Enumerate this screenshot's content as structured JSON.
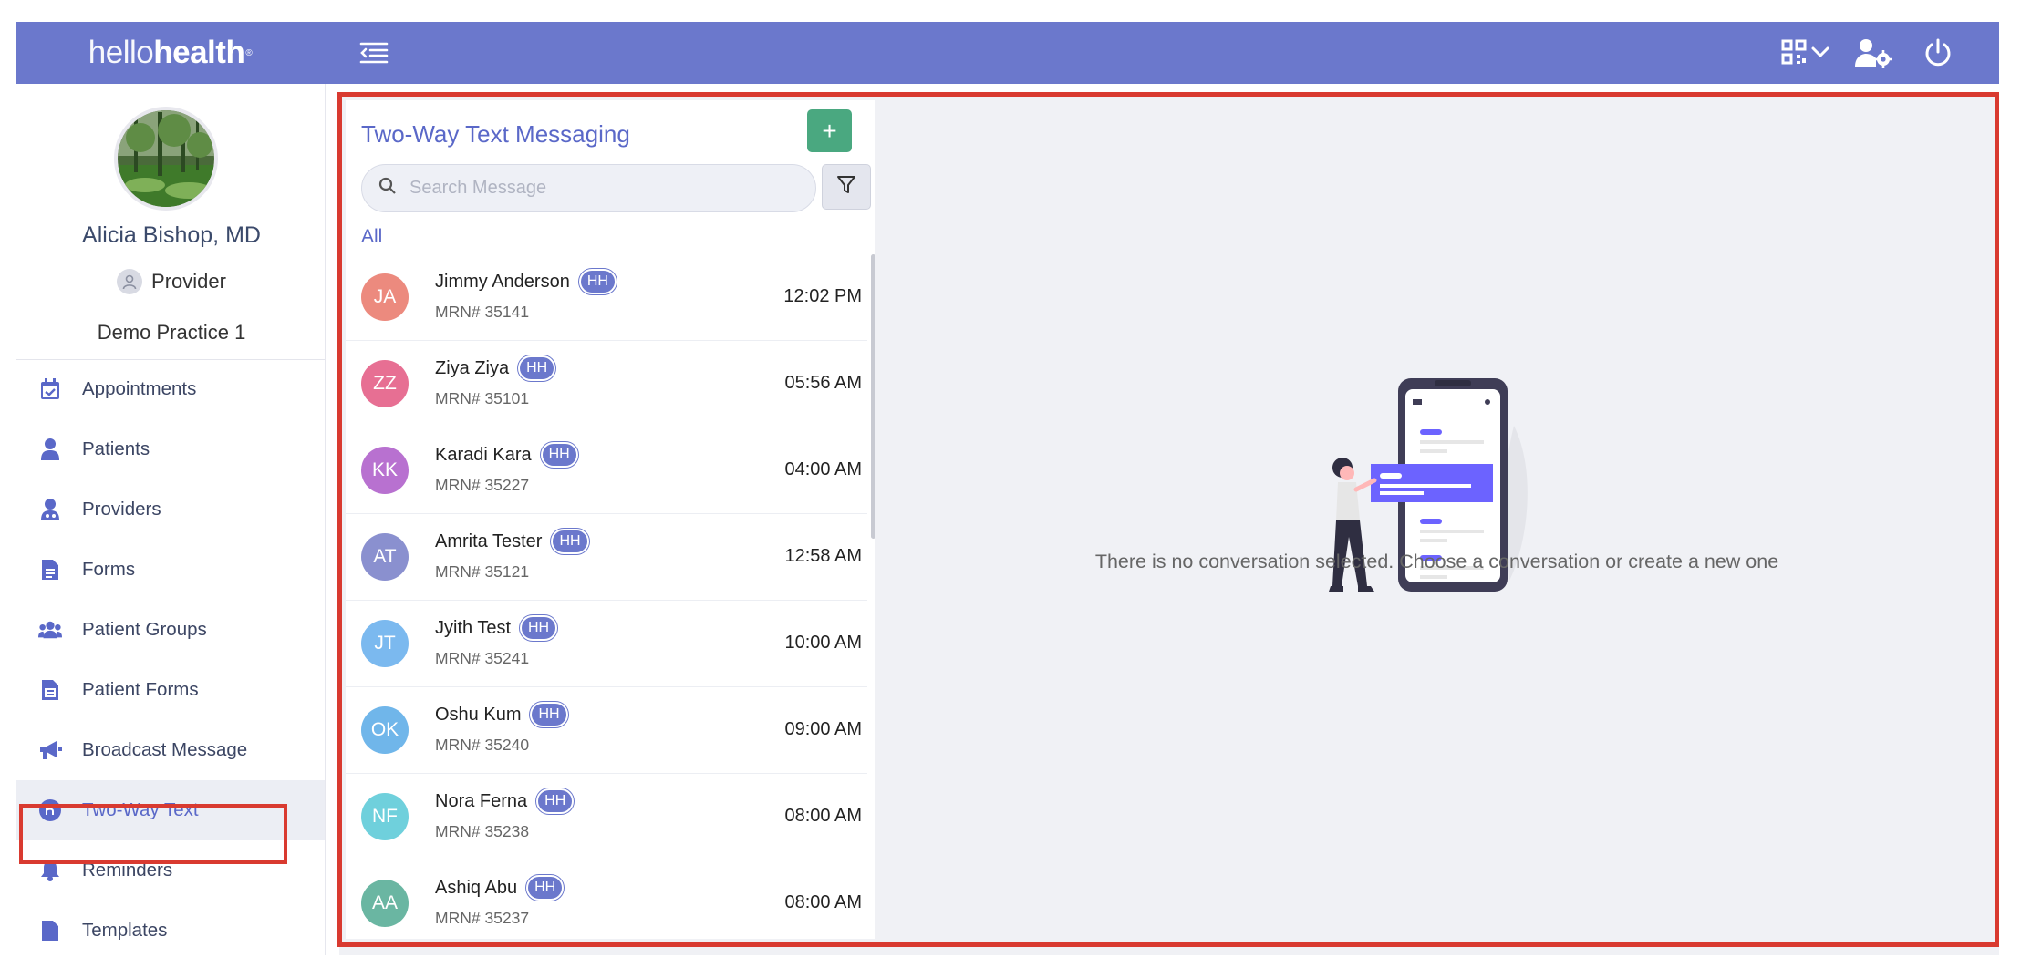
{
  "topbar": {
    "logo_light": "hello",
    "logo_bold": "health",
    "logo_mark": "®",
    "icons": [
      "menu-toggle-icon",
      "qr-code-icon",
      "user-settings-icon",
      "power-icon"
    ]
  },
  "profile": {
    "name": "Alicia Bishop, MD",
    "role": "Provider",
    "practice": "Demo Practice 1"
  },
  "sidebar": {
    "items": [
      {
        "label": "Appointments",
        "icon": "calendar-check-icon"
      },
      {
        "label": "Patients",
        "icon": "user-icon"
      },
      {
        "label": "Providers",
        "icon": "doctor-icon"
      },
      {
        "label": "Forms",
        "icon": "document-icon"
      },
      {
        "label": "Patient Groups",
        "icon": "users-icon"
      },
      {
        "label": "Patient Forms",
        "icon": "clipboard-icon"
      },
      {
        "label": "Broadcast Message",
        "icon": "megaphone-icon"
      },
      {
        "label": "Two-Way Text",
        "icon": "chat-icon",
        "active": true
      },
      {
        "label": "Reminders",
        "icon": "bell-icon"
      },
      {
        "label": "Templates",
        "icon": "file-icon"
      }
    ]
  },
  "messaging": {
    "title": "Two-Way Text Messaging",
    "add_label": "+",
    "search_placeholder": "Search Message",
    "tab_all": "All",
    "badge": "HH",
    "conversations": [
      {
        "initials": "JA",
        "name": "Jimmy Anderson",
        "mrn": "MRN# 35141",
        "time": "12:02 PM",
        "color": "#ec8a7e"
      },
      {
        "initials": "ZZ",
        "name": "Ziya Ziya",
        "mrn": "MRN# 35101",
        "time": "05:56 AM",
        "color": "#e76f93"
      },
      {
        "initials": "KK",
        "name": "Karadi Kara",
        "mrn": "MRN# 35227",
        "time": "04:00 AM",
        "color": "#b871d0"
      },
      {
        "initials": "AT",
        "name": "Amrita Tester",
        "mrn": "MRN# 35121",
        "time": "12:58 AM",
        "color": "#8a90cf"
      },
      {
        "initials": "JT",
        "name": "Jyith Test",
        "mrn": "MRN# 35241",
        "time": "10:00 AM",
        "color": "#7bb9ef"
      },
      {
        "initials": "OK",
        "name": "Oshu Kum",
        "mrn": "MRN# 35240",
        "time": "09:00 AM",
        "color": "#70b6ea"
      },
      {
        "initials": "NF",
        "name": "Nora Ferna",
        "mrn": "MRN# 35238",
        "time": "08:00 AM",
        "color": "#6fd0dc"
      },
      {
        "initials": "AA",
        "name": "Ashiq Abu",
        "mrn": "MRN# 35237",
        "time": "08:00 AM",
        "color": "#6ab6a2"
      }
    ],
    "empty_text": "There is no conversation selected. Choose a conversation or create a new one"
  },
  "colors": {
    "brand": "#6b78cc",
    "accent_text": "#5a68c8",
    "add_button": "#4aa880",
    "highlight_border": "#d93a30"
  }
}
